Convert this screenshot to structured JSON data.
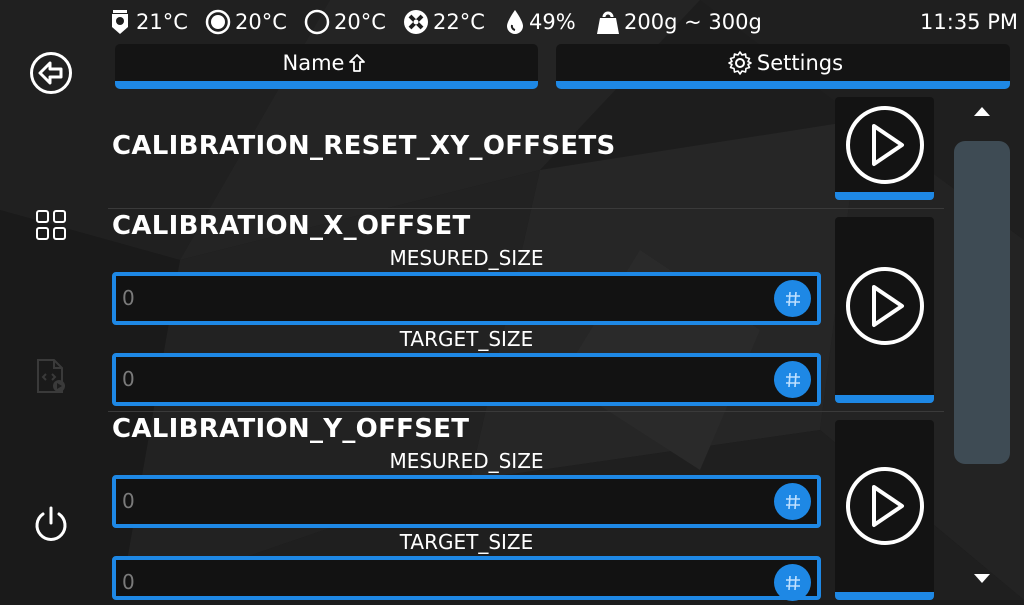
{
  "status_bar": {
    "extruder_temp": "21°C",
    "bed_temp": "20°C",
    "chamber_temp": "20°C",
    "fan_temp": "22°C",
    "humidity": "49%",
    "weight": "200g ~ 300g",
    "clock": "11:35 PM",
    "icons": [
      "extruder-icon",
      "bed-icon",
      "chamber-icon",
      "fan-icon",
      "humidity-icon",
      "weight-icon"
    ]
  },
  "nav": {
    "items": [
      "back-icon",
      "grid-icon",
      "code-file-icon",
      "power-icon"
    ]
  },
  "header": {
    "sort_label": "Name",
    "sort_icon": "arrow-up-icon",
    "settings_label": "Settings",
    "settings_icon": "gear-icon"
  },
  "macros": [
    {
      "name": "CALIBRATION_RESET_XY_OFFSETS",
      "params": []
    },
    {
      "name": "CALIBRATION_X_OFFSET",
      "params": [
        {
          "label": "MESURED_SIZE",
          "placeholder": "0"
        },
        {
          "label": "TARGET_SIZE",
          "placeholder": "0"
        }
      ]
    },
    {
      "name": "CALIBRATION_Y_OFFSET",
      "params": [
        {
          "label": "MESURED_SIZE",
          "placeholder": "0"
        },
        {
          "label": "TARGET_SIZE",
          "placeholder": "0"
        }
      ]
    }
  ],
  "colors": {
    "accent": "#1e88e5",
    "background": "#1c1c1c",
    "scroll_thumb": "#3e4b54"
  }
}
